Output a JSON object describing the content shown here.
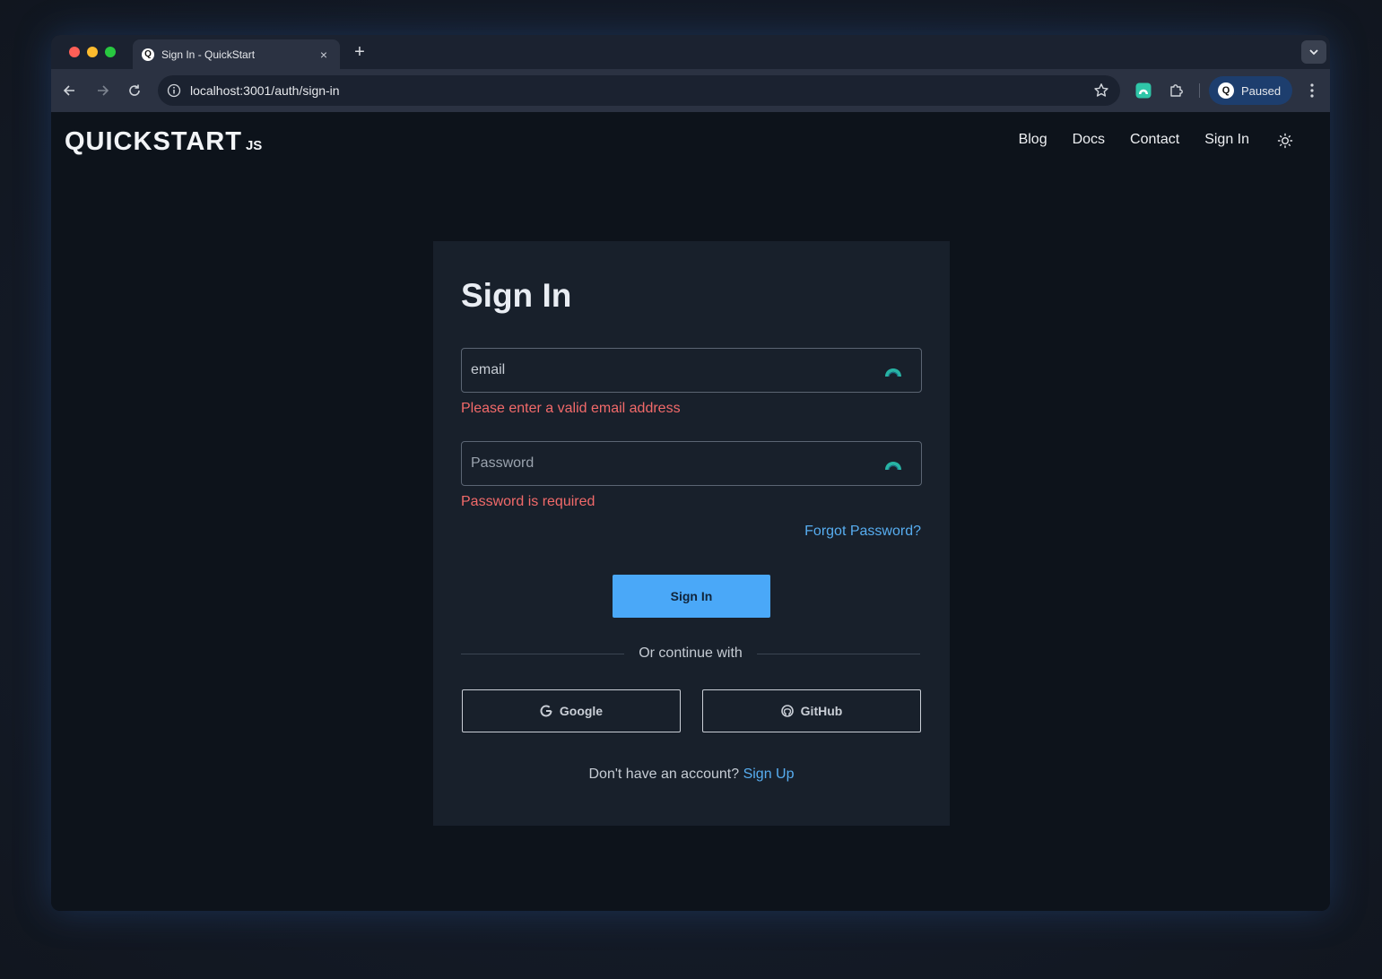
{
  "browser": {
    "tab_title": "Sign In - QuickStart",
    "tab_favicon": "Q",
    "url_host": "localhost",
    "url_rest": ":3001/auth/sign-in",
    "profile_label": "Paused",
    "profile_avatar": "Q"
  },
  "header": {
    "logo_main": "QUICKSTART",
    "logo_sub": "JS",
    "nav": [
      {
        "label": "Blog"
      },
      {
        "label": "Docs"
      },
      {
        "label": "Contact"
      },
      {
        "label": "Sign In"
      }
    ]
  },
  "form": {
    "title": "Sign In",
    "email": {
      "value": "email",
      "placeholder": "email",
      "error": "Please enter a valid email address"
    },
    "password": {
      "value": "",
      "placeholder": "Password",
      "error": "Password is required"
    },
    "forgot_label": "Forgot Password?",
    "submit_label": "Sign In",
    "divider_label": "Or continue with",
    "google_label": "Google",
    "github_label": "GitHub",
    "signup_prompt": "Don't have an account?",
    "signup_link": "Sign Up"
  },
  "colors": {
    "accent": "#4aa8f8",
    "link": "#57adf0",
    "error": "#f26a6a",
    "card_bg": "#18202b",
    "page_bg": "#0d131b"
  },
  "icons": {
    "field_icon": "password-manager-icon",
    "theme_toggle": "sun-icon"
  }
}
